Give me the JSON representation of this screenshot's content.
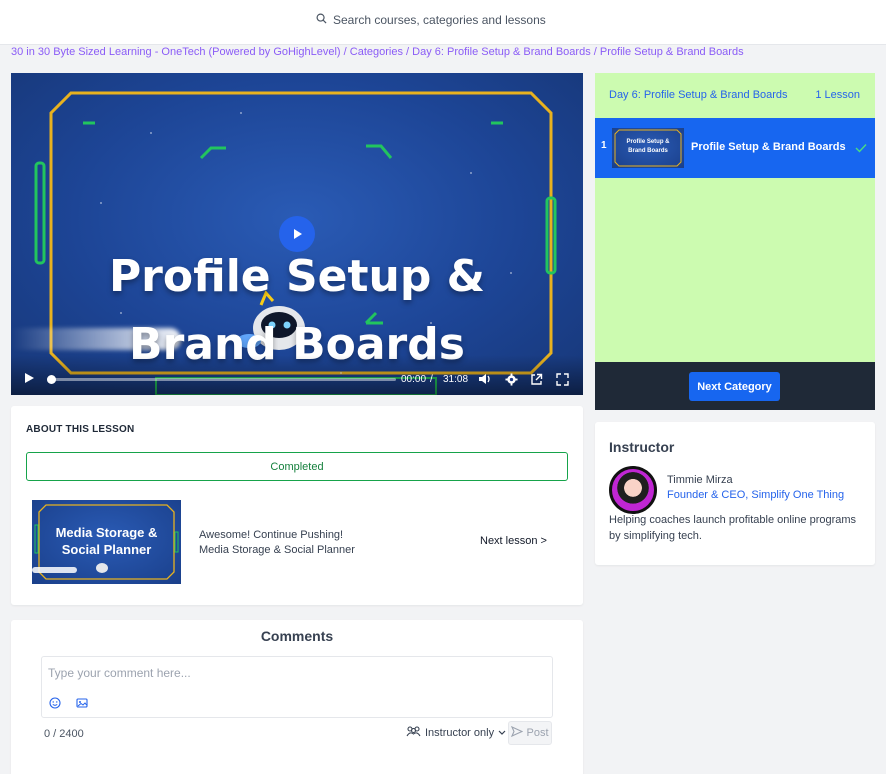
{
  "search": {
    "placeholder": "Search courses, categories and lessons"
  },
  "breadcrumb": {
    "items": [
      "30 in 30 Byte Sized Learning - OneTech (Powered by GoHighLevel)",
      "Categories",
      "Day 6: Profile Setup & Brand Boards",
      "Profile Setup & Brand Boards"
    ],
    "separator": "/"
  },
  "video": {
    "title_line1": "Profile Setup &",
    "title_line2": "Brand Boards",
    "current_time": "00:00",
    "time_separator": "/",
    "duration": "31:08",
    "progress": 0
  },
  "about": {
    "heading": "ABOUT THIS LESSON",
    "completed_label": "Completed",
    "next_thumb_line1": "Media Storage &",
    "next_thumb_line2": "Social Planner",
    "next_line1": "Awesome! Continue Pushing!",
    "next_line2": "Media Storage & Social Planner",
    "next_link": "Next lesson >"
  },
  "comments": {
    "title": "Comments",
    "placeholder": "Type your comment here...",
    "counter": "0 / 2400",
    "visibility": "Instructor only",
    "post_label": "Post"
  },
  "sidebar": {
    "category": "Day 6: Profile Setup & Brand Boards",
    "lesson_count": "1 Lesson",
    "lessons": [
      {
        "number": "1",
        "title": "Profile Setup & Brand Boards",
        "thumb_line1": "Profile Setup &",
        "thumb_line2": "Brand Boards",
        "completed": true
      }
    ],
    "next_category_label": "Next Category"
  },
  "instructor": {
    "heading": "Instructor",
    "name": "Timmie Mirza",
    "role": "Founder & CEO, Simplify One Thing",
    "bio": "Helping coaches launch profitable online programs by simplifying tech."
  },
  "colors": {
    "accent": "#1766f0",
    "sidebar_bg": "#ccfbb0",
    "completed": "#16a34a",
    "breadcrumb": "#8b5cf6"
  }
}
